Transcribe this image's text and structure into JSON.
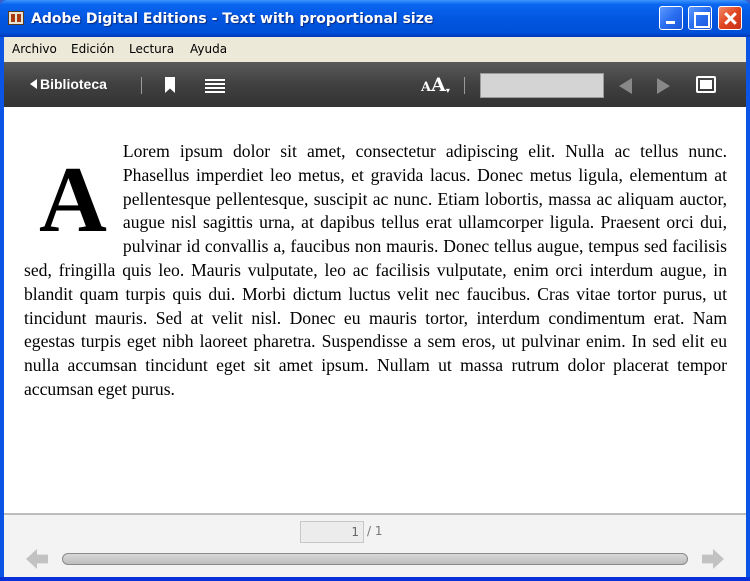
{
  "window": {
    "title": "Adobe Digital Editions - Text with proportional size"
  },
  "menu": {
    "items": [
      "Archivo",
      "Edición",
      "Lectura",
      "Ayuda"
    ]
  },
  "toolbar": {
    "library_label": "Biblioteca",
    "font_size_label_small": "A",
    "font_size_label_big": "A",
    "search_value": ""
  },
  "reader": {
    "drop_cap": "A",
    "text": "Lorem ipsum dolor sit amet, consectetur adipiscing elit. Nulla ac tellus nunc. Phasellus imperdiet leo metus, et gravida lacus. Donec metus ligula, elemen­tum at pellentesque pellentesque, suscipit ac nunc. Etiam lobortis, massa ac aliquam auctor, augue nisl sagittis urna, at dapibus tellus erat ullamcorper ligula. Praesent orci dui, pulvinar id convallis a, faucibus non mauris. Donec tellus augue, tempus sed facilisis sed, fringilla quis leo. Mauris vulputate, leo ac facilisis vulputate, enim orci interdum augue, in blandit quam turpis quis dui. Morbi dictum luc­tus velit nec faucibus. Cras vitae tortor purus, ut tincidunt mauris. Sed at velit nisl. Donec eu mauris tortor, interdum condimentum erat. Nam egestas turpis eget nibh laoreet phare­tra. Suspendisse a sem eros, ut pulvinar enim. In sed elit eu nulla accumsan tincidunt eget sit amet ipsum. Nullam ut massa rutrum dolor placerat tempor accumsan eget purus."
  },
  "footer": {
    "current_page": "1",
    "total_pages": "/ 1",
    "reading_progress": 1.0
  },
  "icons": [
    "app-icon",
    "minimize-icon",
    "maximize-icon",
    "close-icon",
    "back-arrow-icon",
    "bookmark-icon",
    "toc-icon",
    "font-size-icon",
    "previous-icon",
    "next-icon",
    "fullscreen-icon",
    "prev-page-icon",
    "next-page-icon"
  ],
  "colors": {
    "titlebar": "#0256e1",
    "menubar": "#ece9d8",
    "toolbar": "#404040",
    "page": "#ffffff"
  }
}
